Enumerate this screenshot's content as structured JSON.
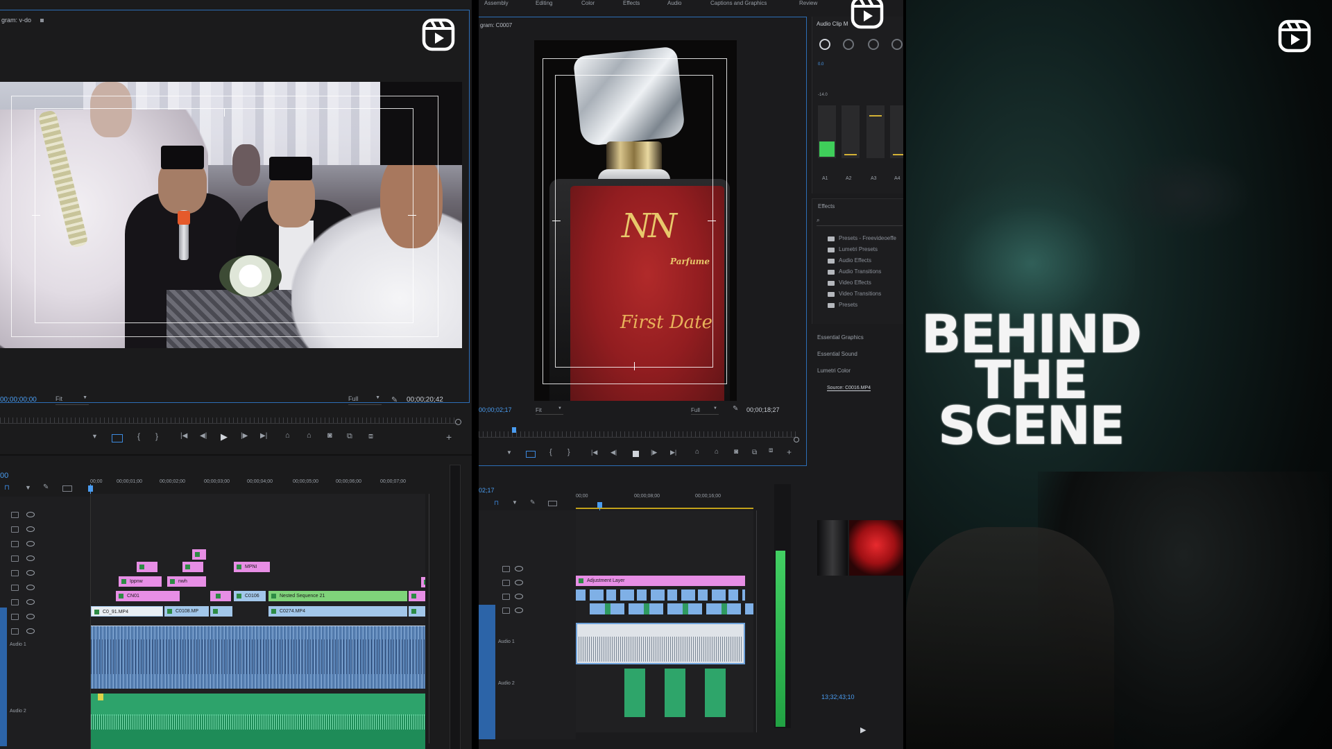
{
  "left_panel": {
    "program_title": "gram: v-do",
    "timecode_start": "00;00;00;00",
    "fit_label": "Fit",
    "quality_label": "Full",
    "timecode_end": "00;00;20;42",
    "timeline_timecode": "00",
    "ruler_ticks": [
      "00;00",
      "00;00;01;00",
      "00;00;02;00",
      "00;00;03;00",
      "00;00;04;00",
      "00;00;05;00",
      "00;00;06;00",
      "00;00;07;00"
    ],
    "clips": {
      "v5": "MPNI",
      "v4": "Ippnw",
      "v3": "nwh",
      "v2": "CN01",
      "v1_a": "C0_01.MP4",
      "v1_b": "C0106.MP",
      "v1_c": "C0106",
      "v1_d": "Nested Sequence 21",
      "v0_a": "C0_91.MP4",
      "v0_b": "C0108.MP",
      "v0_c": "C0274.MP4"
    },
    "audio_labels": [
      "Audio 1",
      "Audio 2"
    ]
  },
  "middle_panel": {
    "workspace_tabs": [
      "Assembly",
      "Editing",
      "Color",
      "Effects",
      "Audio",
      "Captions and Graphics",
      "Review"
    ],
    "program_title": "gram: C0007",
    "product_brand": "NN",
    "product_sub": "Parfume",
    "product_name": "First Date",
    "timecode_start": "00;00;02;17",
    "fit_label": "Fit",
    "quality_label": "Full",
    "timecode_end": "00;00;18;27",
    "timeline_timecode": "02;17",
    "ruler_ticks": [
      "00;00",
      "00;00;08;00",
      "00;00;16;00"
    ],
    "adjustment_layer": "Adjustment Layer",
    "audio_labels": [
      "Audio 1",
      "Audio 2"
    ],
    "audio_clip_mixer_title": "Audio Clip M",
    "mixer_values": [
      "0.0",
      "-14.0"
    ],
    "channel_labels": [
      "A1",
      "A2",
      "A3",
      "A4"
    ],
    "effects_title": "Effects",
    "effects_items": [
      "Presets - Freevideoeffe",
      "Lumetri Presets",
      "Audio Effects",
      "Audio Transitions",
      "Video Effects",
      "Video Transitions",
      "Presets"
    ],
    "panels": [
      "Essential Graphics",
      "Essential Sound",
      "Lumetri Color"
    ],
    "source_label": "Source: C0016.MP4",
    "source_timecode": "13;32;43;10"
  },
  "right_panel": {
    "title_lines": [
      "BEHIND",
      "THE",
      "SCENE"
    ]
  },
  "icons": {
    "reels": "instagram-reels-icon"
  }
}
